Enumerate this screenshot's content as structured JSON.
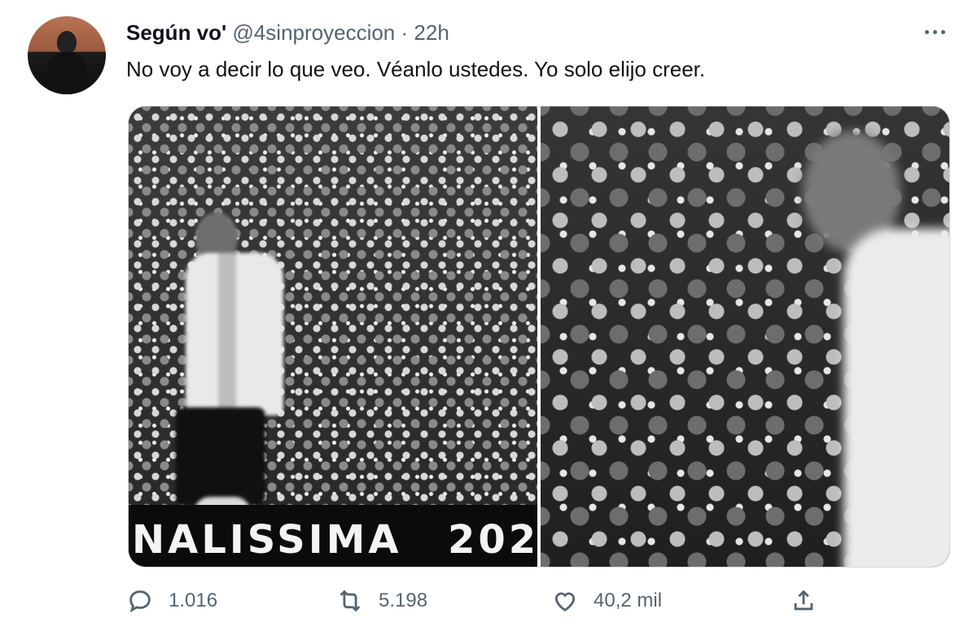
{
  "tweet": {
    "display_name": "Según vo'",
    "handle": "@4sinproyeccion",
    "separator": "·",
    "time": "22h",
    "text": "No voy a decir lo que veo. Véanlo ustedes. Yo solo elijo creer.",
    "more_icon": "ellipsis-icon"
  },
  "media": {
    "left_banner_text": "NALISSIMA",
    "left_banner_year": "202"
  },
  "actions": {
    "reply": {
      "icon": "reply-icon",
      "count": "1.016"
    },
    "retweet": {
      "icon": "retweet-icon",
      "count": "5.198"
    },
    "like": {
      "icon": "heart-icon",
      "count": "40,2 mil"
    },
    "share": {
      "icon": "share-icon"
    }
  },
  "colors": {
    "text_primary": "#0f1419",
    "text_secondary": "#536471",
    "border": "#cfd9de"
  }
}
